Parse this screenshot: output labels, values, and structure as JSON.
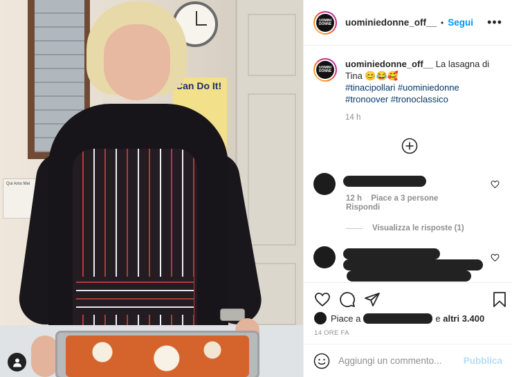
{
  "post": {
    "username": "uominiedonne_off__",
    "follow_label": "Segui",
    "more_label": "•••",
    "avatar_text": "UOMINI DONNE",
    "caption_username": "uominiedonne_off__",
    "caption_text": "La lasagna di Tina 😊😂🥰",
    "hashtags": "#tinacipollari #uominiedonne #tronoover #tronoclassico",
    "caption_age": "14 h",
    "poster_text": "Can Do It!",
    "shelf_sign_text": "Qui Amo Mei"
  },
  "comments": [
    {
      "age": "12 h",
      "likes": "Piace a 3 persone",
      "reply_label": "Rispondi"
    }
  ],
  "view_replies_label": "Visualizza le risposte (1)",
  "likes": {
    "prefix": "Piace a",
    "and_label": "e",
    "count_label": "altri 3.400"
  },
  "timestamp": "14 ORE FA",
  "comment_box": {
    "placeholder": "Aggiungi un commento...",
    "publish_label": "Pubblica"
  },
  "colors": {
    "link_blue": "#0095f6",
    "hashtag_blue": "#00376b",
    "publish_disabled": "#b2dffc",
    "meta_gray": "#8e8e8e"
  },
  "icons": [
    "user-tag-icon",
    "more-options-icon",
    "add-circle-icon",
    "heart-icon",
    "comment-icon",
    "share-icon",
    "bookmark-icon",
    "emoji-icon"
  ]
}
